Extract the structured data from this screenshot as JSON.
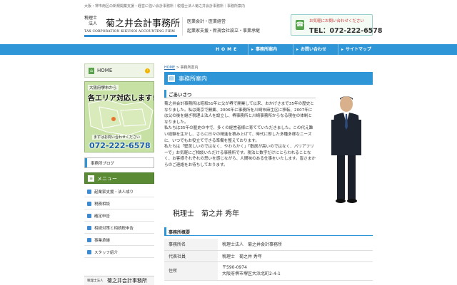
{
  "site": {
    "top_text": "大阪・堺市南区の新規開業支援・経営に強い会計事務所｜税理士法人菊之井会計事務所｜事務所案内",
    "logo_mark_line1": "税理士",
    "logo_mark_line2": "法人",
    "logo_name": "菊之井会計事務所",
    "logo_sub": "TAX CORPORATION KIKUNOI ACCOUNTING FIRM",
    "tagline_line1": "医業会計・医業経営",
    "tagline_line2": "起業家支援・新規会社設立・事業承継",
    "contact_label": "お気軽にお問い合わせください",
    "contact_tel": "TEL：072-222-6578"
  },
  "nav": {
    "home": "HOME",
    "items": [
      "事務所案内",
      "お問い合わせ",
      "サイトマップ"
    ]
  },
  "breadcrumb": {
    "home": "HOME",
    "sep": " > ",
    "current": "事務所案内"
  },
  "sidebar": {
    "home_label": "HOME",
    "banner_line1": "大阪府堺市から",
    "banner_line2": "各エリア対応します!",
    "banner_line3": "まずはお問い合わせください",
    "banner_tel": "072-222-6578",
    "blog_label": "事務所ブログ",
    "menu_title": "メニュー",
    "menu_items": [
      "起業家支援・法人成り",
      "税務相談",
      "確定申告",
      "相続対策と相続税申告",
      "事業承継",
      "スタッフ紹介"
    ],
    "footer_mark": "税理士法人",
    "footer_name": "菊之井会計事務所"
  },
  "main": {
    "title": "事務所案内",
    "greeting_title": "ごあいさつ",
    "greeting_body": "菊之井会計事務所は昭和51年に父が堺で開業して以来、おかげさまで35年の歴史となりました。私は東京で開業、2006年に事務所を川崎市麻生区に移転、2007年には父の後を継ぎ税理士法人を設立し、堺事務所と川崎事務所からなる現在の体制となりました。\n私たちは35年の歴史の中で、多くの経営者様に育てていただきました。この代え難い経験を生かし、さらに日々の精進を積み上げて、時代に即した多種多様なニーズに、いつでもお役立てできる準備を整えております。\n私たちは「堅苦しいのではなく、やわらかく」「敷居が高いのではなく、バリアフリーで」お気軽にご相談いただける事務所です。税法と数字だけにとらわれることなく、お客様それぞれの思いを感じながら、人間味のある仕事をいたします。皆さまからのご連絡をお待ちしております。",
    "signature": "税理士　菊之井 秀年",
    "office_title": "事務所概要",
    "office_rows": [
      {
        "key": "事務所名",
        "value": "税理士法人　菊之井会計事務所"
      },
      {
        "key": "代表社員",
        "value": "税理士　菊之井 秀年"
      },
      {
        "key": "住所",
        "value_line1": "〒590-0974",
        "value_line2": "大阪府堺市堺区大浜北町2-4-1"
      }
    ]
  },
  "colors": {
    "accent_blue": "#2e95d6",
    "menu_green": "#5a8a34",
    "tel_blue": "#1b5fa8"
  }
}
